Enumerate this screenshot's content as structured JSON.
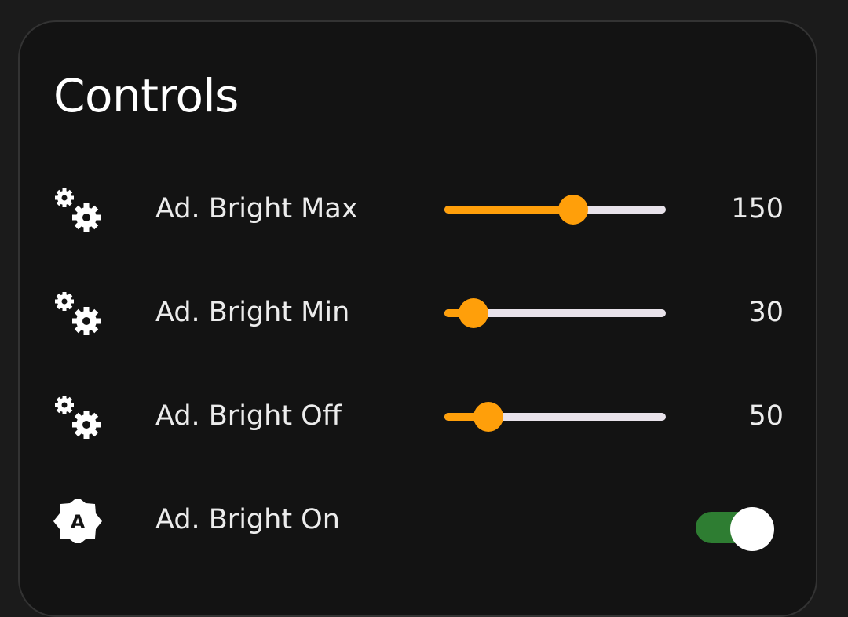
{
  "card": {
    "title": "Controls"
  },
  "rows": [
    {
      "icon": "gears-icon",
      "label": "Ad. Bright Max",
      "value": "150",
      "slider_fraction": 0.58
    },
    {
      "icon": "gears-icon",
      "label": "Ad. Bright Min",
      "value": "30",
      "slider_fraction": 0.13
    },
    {
      "icon": "gears-icon",
      "label": "Ad. Bright Off",
      "value": "50",
      "slider_fraction": 0.2
    },
    {
      "icon": "auto-brightness-icon",
      "label": "Ad. Bright On",
      "toggle_on": true
    }
  ],
  "colors": {
    "accent": "#ff9f0a",
    "toggle_on": "#2e7d32",
    "track": "#e8e2ea",
    "card_bg": "#131313",
    "page_bg": "#1b1b1b"
  }
}
